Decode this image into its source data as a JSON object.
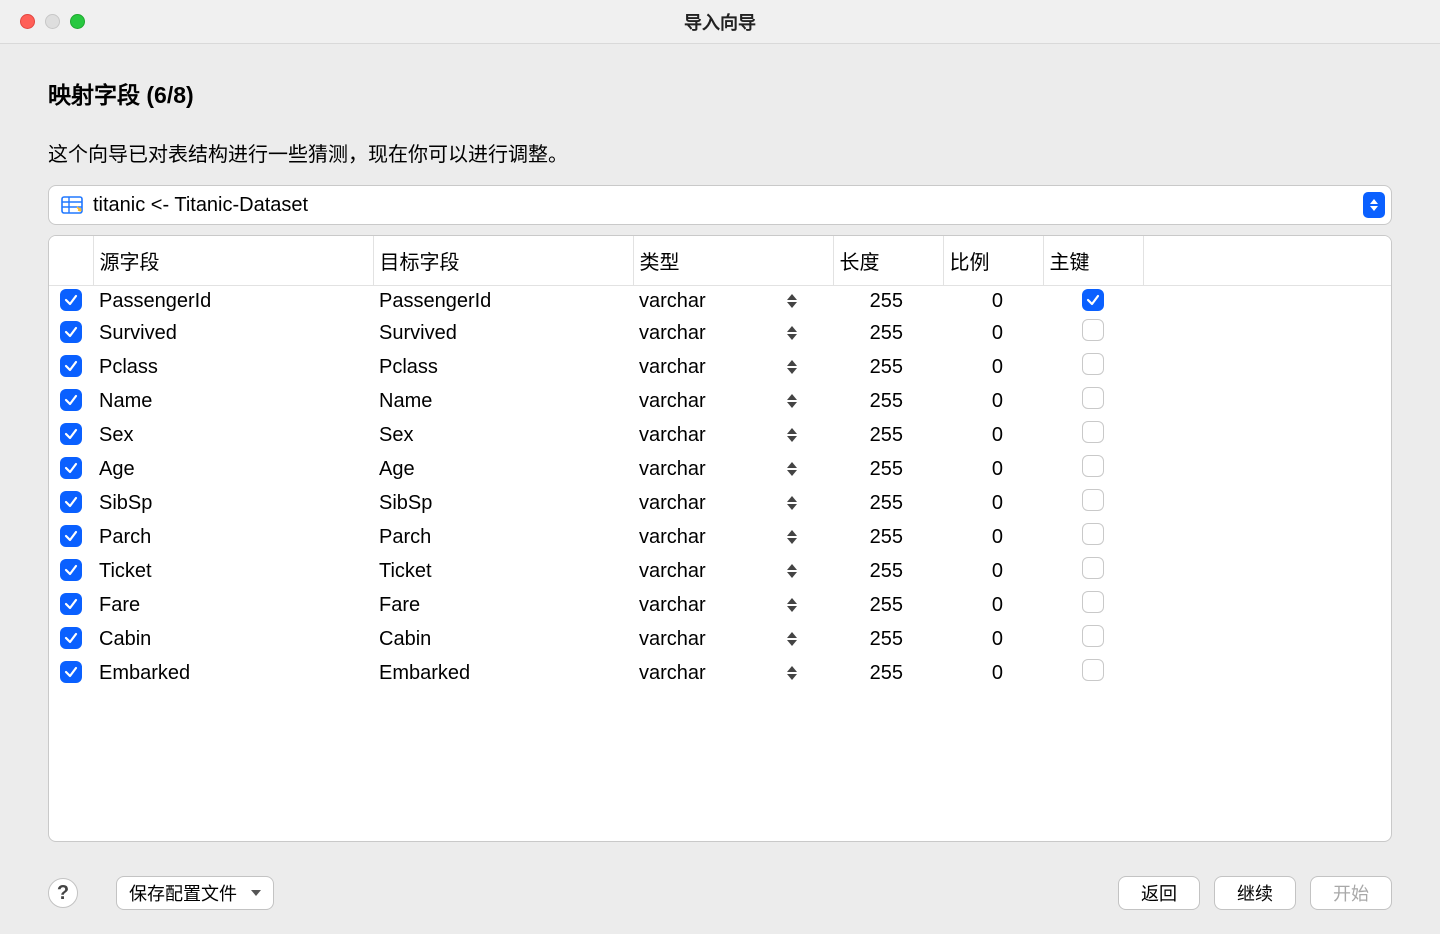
{
  "window": {
    "title": "导入向导"
  },
  "step": {
    "title": "映射字段 (6/8)",
    "description": "这个向导已对表结构进行一些猜测，现在你可以进行调整。"
  },
  "mapping": {
    "label": "titanic <- Titanic-Dataset"
  },
  "columns": {
    "source": "源字段",
    "target": "目标字段",
    "type": "类型",
    "length": "长度",
    "scale": "比例",
    "primary": "主键"
  },
  "rows": [
    {
      "checked": true,
      "source": "PassengerId",
      "target": "PassengerId",
      "type": "varchar",
      "length": "255",
      "scale": "0",
      "pk": true
    },
    {
      "checked": true,
      "source": "Survived",
      "target": "Survived",
      "type": "varchar",
      "length": "255",
      "scale": "0",
      "pk": false
    },
    {
      "checked": true,
      "source": "Pclass",
      "target": "Pclass",
      "type": "varchar",
      "length": "255",
      "scale": "0",
      "pk": false
    },
    {
      "checked": true,
      "source": "Name",
      "target": "Name",
      "type": "varchar",
      "length": "255",
      "scale": "0",
      "pk": false
    },
    {
      "checked": true,
      "source": "Sex",
      "target": "Sex",
      "type": "varchar",
      "length": "255",
      "scale": "0",
      "pk": false
    },
    {
      "checked": true,
      "source": "Age",
      "target": "Age",
      "type": "varchar",
      "length": "255",
      "scale": "0",
      "pk": false
    },
    {
      "checked": true,
      "source": "SibSp",
      "target": "SibSp",
      "type": "varchar",
      "length": "255",
      "scale": "0",
      "pk": false
    },
    {
      "checked": true,
      "source": "Parch",
      "target": "Parch",
      "type": "varchar",
      "length": "255",
      "scale": "0",
      "pk": false
    },
    {
      "checked": true,
      "source": "Ticket",
      "target": "Ticket",
      "type": "varchar",
      "length": "255",
      "scale": "0",
      "pk": false
    },
    {
      "checked": true,
      "source": "Fare",
      "target": "Fare",
      "type": "varchar",
      "length": "255",
      "scale": "0",
      "pk": false
    },
    {
      "checked": true,
      "source": "Cabin",
      "target": "Cabin",
      "type": "varchar",
      "length": "255",
      "scale": "0",
      "pk": false
    },
    {
      "checked": true,
      "source": "Embarked",
      "target": "Embarked",
      "type": "varchar",
      "length": "255",
      "scale": "0",
      "pk": false
    }
  ],
  "footer": {
    "help": "?",
    "saveProfile": "保存配置文件",
    "back": "返回",
    "continue": "继续",
    "start": "开始"
  }
}
